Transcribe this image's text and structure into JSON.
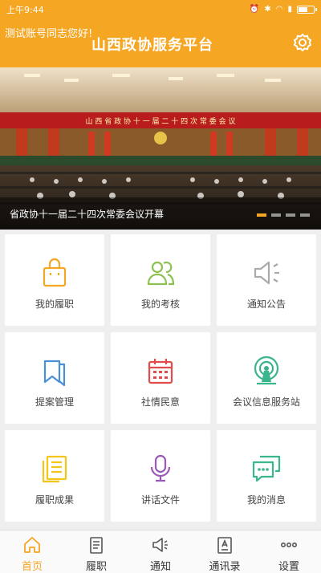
{
  "status_bar": {
    "time": "上午9:44",
    "battery_level": 0.7
  },
  "header": {
    "greeting": "测试账号同志您好!",
    "title": "山西政协服务平台"
  },
  "banner": {
    "caption": "省政协十一届二十四次常委会议开幕",
    "hall_sign": "山 西 省 政 协 十 一 届 二 十 四 次 常 委 会 议",
    "slide_count": 4,
    "active_slide": 1
  },
  "grid": [
    {
      "id": "my-duty",
      "label": "我的履职",
      "icon": "bag-icon",
      "color": "#f5a623"
    },
    {
      "id": "my-assessment",
      "label": "我的考核",
      "icon": "people-icon",
      "color": "#8cc152"
    },
    {
      "id": "notices",
      "label": "通知公告",
      "icon": "speaker-icon",
      "color": "#aaaaaa"
    },
    {
      "id": "proposals",
      "label": "提案管理",
      "icon": "bookmark-icon",
      "color": "#4a90d9"
    },
    {
      "id": "public-opinion",
      "label": "社情民意",
      "icon": "calendar-icon",
      "color": "#e04b4b"
    },
    {
      "id": "meeting-service",
      "label": "会议信息服务站",
      "icon": "signal-icon",
      "color": "#3ab58e"
    },
    {
      "id": "duty-results",
      "label": "履职成果",
      "icon": "document-icon",
      "color": "#f5c518"
    },
    {
      "id": "speeches",
      "label": "讲话文件",
      "icon": "microphone-icon",
      "color": "#9b59b6"
    },
    {
      "id": "my-messages",
      "label": "我的消息",
      "icon": "chat-icon",
      "color": "#3ab58e"
    }
  ],
  "bottom_nav": [
    {
      "id": "home",
      "label": "首页",
      "icon": "home-icon",
      "active": true
    },
    {
      "id": "duty",
      "label": "履职",
      "icon": "clipboard-icon",
      "active": false
    },
    {
      "id": "notice",
      "label": "通知",
      "icon": "speaker-icon",
      "active": false
    },
    {
      "id": "contacts",
      "label": "通讯录",
      "icon": "contacts-icon",
      "active": false
    },
    {
      "id": "settings",
      "label": "设置",
      "icon": "more-icon",
      "active": false
    }
  ],
  "colors": {
    "brand": "#f5a623",
    "tab_active": "#f5a623"
  }
}
